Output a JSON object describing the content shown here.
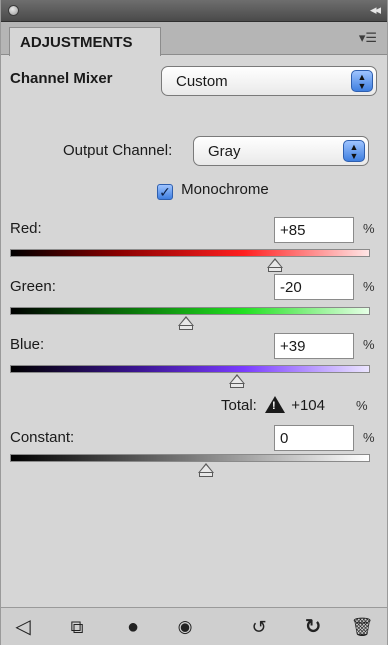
{
  "panel": {
    "tab_label": "ADJUSTMENTS",
    "collapse_icon": "double-chevron-right-icon",
    "menu_icon": "panel-menu-icon"
  },
  "preset": {
    "label": "Channel Mixer",
    "value": "Custom"
  },
  "output_channel": {
    "label": "Output Channel:",
    "value": "Gray"
  },
  "monochrome": {
    "label": "Monochrome",
    "checked": true
  },
  "channels": [
    {
      "label": "Red:",
      "value": "+85",
      "unit": "%",
      "level": 85
    },
    {
      "label": "Green:",
      "value": "-20",
      "unit": "%",
      "level": -20
    },
    {
      "label": "Blue:",
      "value": "+39",
      "unit": "%",
      "level": 39
    }
  ],
  "total": {
    "label": "Total:",
    "value": "+104",
    "unit": "%",
    "icon": "warning-icon"
  },
  "constant": {
    "label": "Constant:",
    "value": "0",
    "unit": "%",
    "level": 0
  },
  "toolbar": {
    "icons": [
      "back-arrow-icon",
      "clip-to-layer-icon",
      "toggle-visibility-circle-icon",
      "eye-icon",
      "view-previous-state-icon",
      "reset-icon",
      "trash-icon"
    ]
  },
  "colors": {
    "accent": "#3f7fe0",
    "panel_bg": "#d6d6d6",
    "tab_strip": "#b5b5b5"
  }
}
